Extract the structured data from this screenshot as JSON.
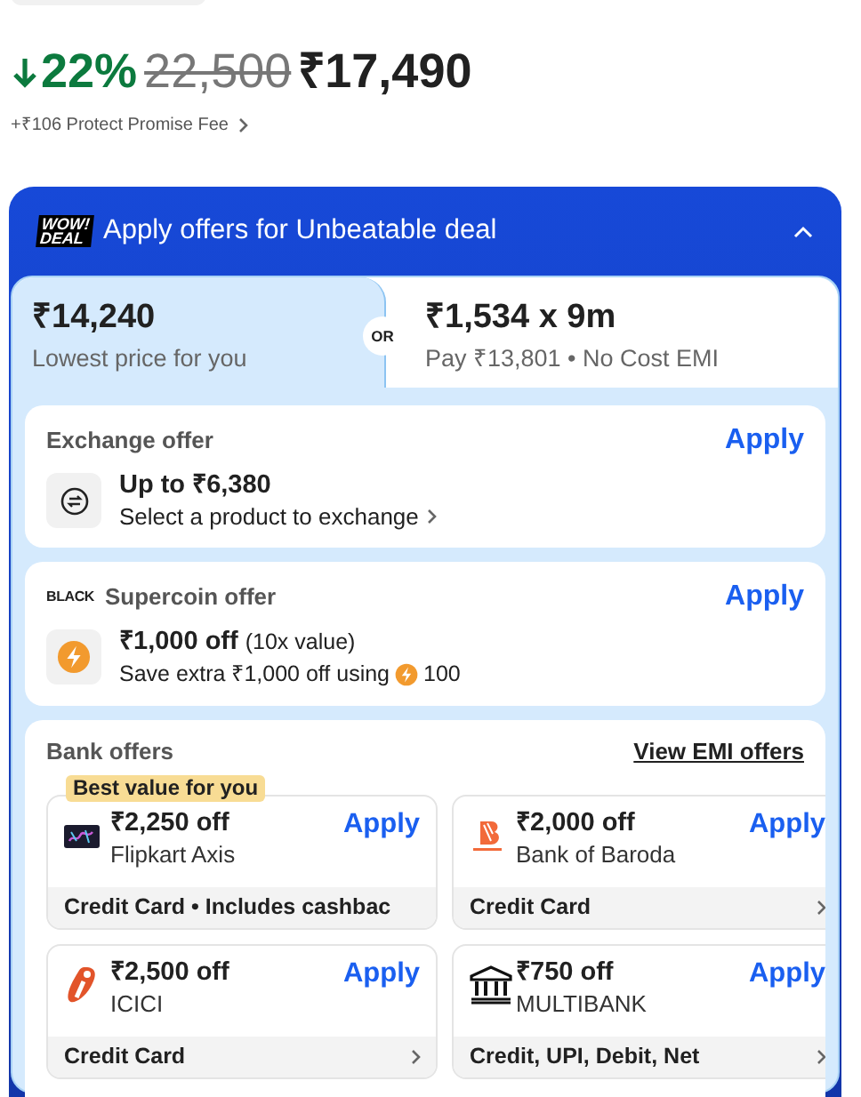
{
  "price": {
    "discount": "22%",
    "mrp": "22,500",
    "final": "₹17,490",
    "fee": "+₹106 Protect Promise Fee"
  },
  "offers_panel": {
    "badge_top": "WOW!",
    "badge_bottom": "DEAL",
    "title": "Apply offers for Unbeatable deal",
    "expanded": true,
    "options": [
      {
        "amount": "₹14,240",
        "caption": "Lowest price for you",
        "selected": true
      },
      {
        "amount": "₹1,534 x 9m",
        "caption": "Pay ₹13,801 • No Cost EMI",
        "selected": false
      }
    ],
    "separator": "OR",
    "exchange": {
      "title": "Exchange offer",
      "action": "Apply",
      "headline": "Up to ₹6,380",
      "detail": "Select a product to exchange"
    },
    "supercoin": {
      "brand": "BLACK",
      "title": "Supercoin offer",
      "action": "Apply",
      "headline": "₹1,000 off",
      "note": "(10x value)",
      "detail": "Save extra ₹1,000 off using",
      "coins": "100"
    },
    "bank": {
      "title": "Bank offers",
      "link": "View EMI offers",
      "tag": "Best value for you",
      "cards": [
        {
          "kind": "card",
          "amount": "₹2,250 off",
          "bank": "Flipkart Axis",
          "action": "Apply",
          "footer": "Credit Card • Includes cashbac",
          "chevron": false
        },
        {
          "kind": "bob",
          "amount": "₹2,000 off",
          "bank": "Bank of Baroda",
          "action": "Apply",
          "footer": "Credit Card",
          "chevron": true
        },
        {
          "kind": "icici",
          "amount": "₹2,500 off",
          "bank": "ICICI",
          "action": "Apply",
          "footer": "Credit Card",
          "chevron": true
        },
        {
          "kind": "bank",
          "amount": "₹750 off",
          "bank": "MULTIBANK",
          "action": "Apply",
          "footer": "Credit, UPI, Debit, Net",
          "chevron": true
        }
      ]
    }
  }
}
